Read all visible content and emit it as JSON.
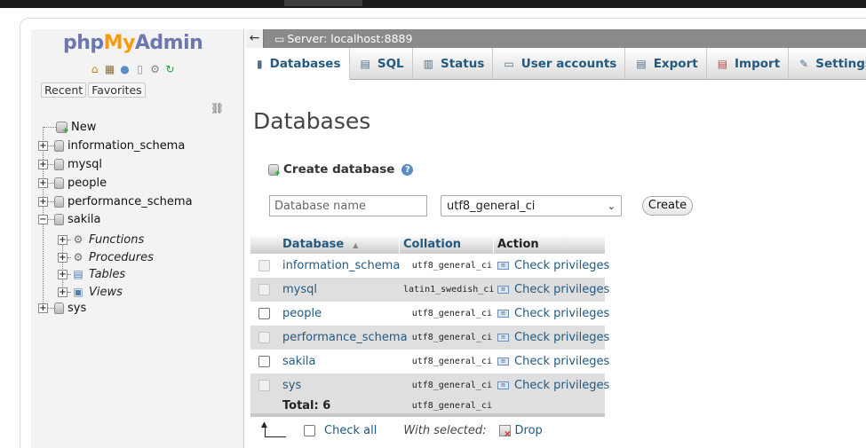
{
  "app": {
    "logo_php": "php",
    "logo_my": "My",
    "logo_admin": "Admin"
  },
  "nav": {
    "tabs": [
      "Recent",
      "Favorites"
    ],
    "tree": {
      "new": "New",
      "databases": [
        "information_schema",
        "mysql",
        "people",
        "performance_schema",
        "sakila",
        "sys"
      ],
      "sakila_children": [
        "Functions",
        "Procedures",
        "Tables",
        "Views"
      ]
    }
  },
  "server": {
    "label": "Server: localhost:8889"
  },
  "tabs": [
    {
      "label": "Databases",
      "icon": "database-icon"
    },
    {
      "label": "SQL",
      "icon": "sql-icon"
    },
    {
      "label": "Status",
      "icon": "status-icon"
    },
    {
      "label": "User accounts",
      "icon": "user-accounts-icon"
    },
    {
      "label": "Export",
      "icon": "export-icon"
    },
    {
      "label": "Import",
      "icon": "import-icon"
    },
    {
      "label": "Settings",
      "icon": "settings-icon"
    }
  ],
  "page": {
    "title": "Databases"
  },
  "create": {
    "label": "Create database",
    "name_placeholder": "Database name",
    "collation_value": "utf8_general_ci",
    "button": "Create"
  },
  "table": {
    "headers": {
      "database": "Database",
      "collation": "Collation",
      "action": "Action"
    },
    "rows": [
      {
        "name": "information_schema",
        "collation": "utf8_general_ci",
        "action": "Check privileges"
      },
      {
        "name": "mysql",
        "collation": "latin1_swedish_ci",
        "action": "Check privileges"
      },
      {
        "name": "people",
        "collation": "utf8_general_ci",
        "action": "Check privileges"
      },
      {
        "name": "performance_schema",
        "collation": "utf8_general_ci",
        "action": "Check privileges"
      },
      {
        "name": "sakila",
        "collation": "utf8_general_ci",
        "action": "Check privileges"
      },
      {
        "name": "sys",
        "collation": "utf8_general_ci",
        "action": "Check privileges"
      }
    ],
    "total_label": "Total: 6",
    "total_collation": "utf8_general_ci"
  },
  "footer": {
    "check_all": "Check all",
    "with_selected": "With selected:",
    "drop": "Drop"
  },
  "colors": {
    "link": "#235a81",
    "server_bar": "#8a8a8a",
    "row_alt": "#dfdfdf"
  }
}
